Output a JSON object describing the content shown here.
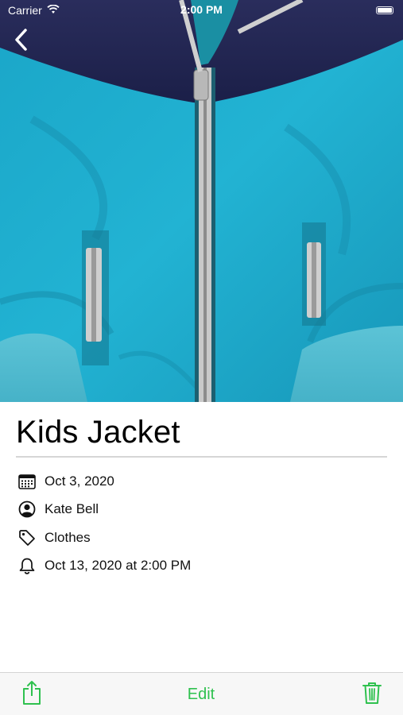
{
  "status_bar": {
    "carrier": "Carrier",
    "time": "2:00 PM"
  },
  "item": {
    "title": "Kids Jacket",
    "details": [
      {
        "icon": "calendar-icon",
        "text": "Oct 3, 2020"
      },
      {
        "icon": "person-circle-icon",
        "text": "Kate Bell"
      },
      {
        "icon": "tag-icon",
        "text": "Clothes"
      },
      {
        "icon": "bell-icon",
        "text": "Oct 13, 2020 at 2:00 PM"
      }
    ]
  },
  "toolbar": {
    "edit_label": "Edit"
  },
  "colors": {
    "accent": "#2fc14f",
    "jacket_body": "#1fa9c9",
    "jacket_collar": "#1f2350"
  }
}
